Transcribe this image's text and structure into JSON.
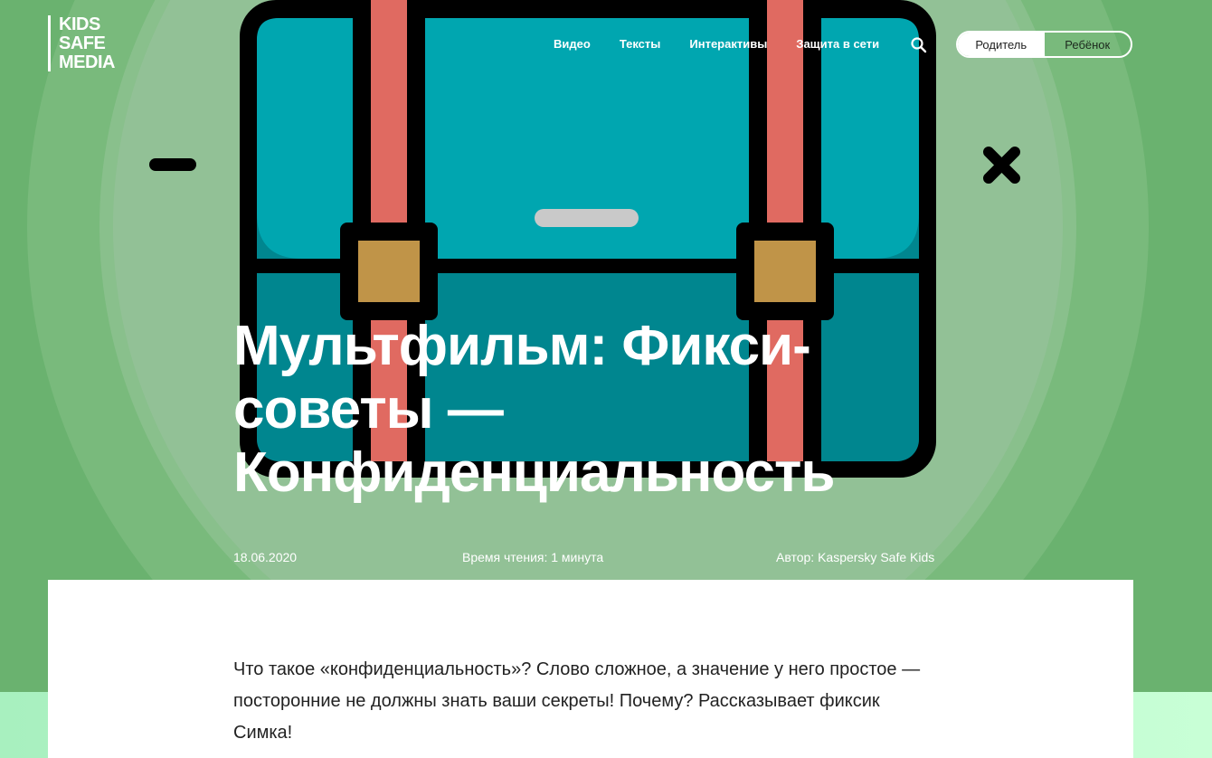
{
  "logo": {
    "line1": "KIDS",
    "line2": "SAFE",
    "line3": "MEDIA"
  },
  "nav": {
    "items": [
      {
        "label": "Видео"
      },
      {
        "label": "Тексты"
      },
      {
        "label": "Интерактивы"
      },
      {
        "label": "Защита в сети"
      }
    ],
    "search_icon": "search-icon"
  },
  "audience_toggle": {
    "parent_label": "Родитель",
    "child_label": "Ребёнок",
    "selected": "parent"
  },
  "hero": {
    "illustration_icon": "briefcase-icon",
    "decor_left_icon": "minus-icon",
    "decor_right_icon": "cross-icon"
  },
  "article": {
    "title_line1": "Мультфильм: Фикси-",
    "title_line2": "советы —",
    "title_line3": "Конфиденциальность",
    "date": "18.06.2020",
    "reading_time": "Время чтения: 1 минута",
    "author": "Автор: Kaspersky Safe Kids",
    "lead": "Что такое «конфиденциальность»? Слово сложное, а значение у него простое — посторонние не должны знать ваши секреты! Почему? Рассказывает фиксик Симка!"
  },
  "colors": {
    "background": "#6ab26f",
    "briefcase_body": "#00a7b1",
    "briefcase_bottom": "#00858f",
    "strap": "#e06a61",
    "buckle": "#c09448",
    "outline": "#000000"
  }
}
